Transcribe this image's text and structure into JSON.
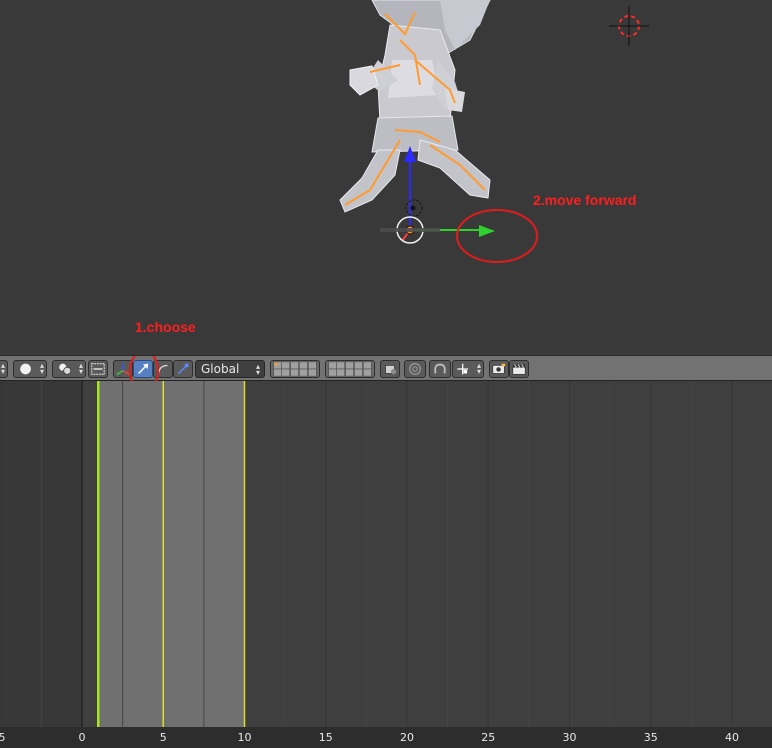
{
  "annotations": {
    "choose": "1.choose",
    "move_forward": "2.move forward"
  },
  "header": {
    "transform_orientation": "Global"
  },
  "timeline": {
    "ticks": [
      "5",
      "0",
      "5",
      "10",
      "15",
      "20",
      "25",
      "30",
      "35",
      "40"
    ],
    "playhead_frame": 1,
    "preview_range_start": 1,
    "preview_range_end": 10,
    "keyframe_marker": 5
  },
  "colors": {
    "annotation": "#ff1e1e",
    "active_button": "#5680c2",
    "axis_x": "#ff3b3b",
    "axis_y": "#2fd12f",
    "axis_z": "#2b2bff",
    "bone_outline": "#ff9b2f",
    "playhead": "#a8e61c"
  },
  "icons": [
    "shading-solid-icon",
    "pivot-icon",
    "manipulator-icon",
    "translate-icon",
    "rotate-icon",
    "scale-icon",
    "layers-icon",
    "lock-icon",
    "snap-icon",
    "render-icon",
    "clapboard-icon"
  ]
}
